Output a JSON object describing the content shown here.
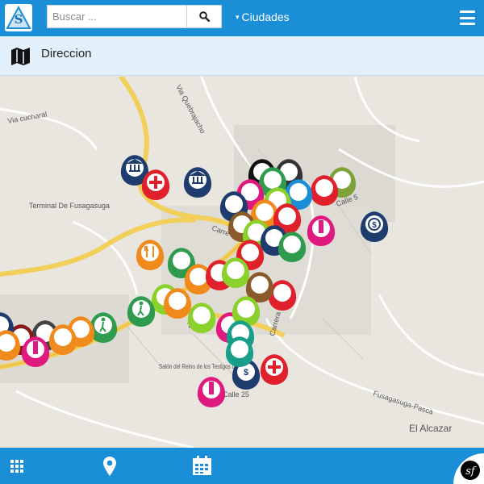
{
  "header": {
    "search_placeholder": "Buscar ...",
    "cities_label": "Ciudades"
  },
  "subbar": {
    "title": "Direccion"
  },
  "map": {
    "streets": [
      "Via cucharal",
      "Via Quebrajacho",
      "Terminal De Fusagasuga",
      "Carre",
      "Carrera 3",
      "Calle 5",
      "Calle 25",
      "Fusagasuga-Pasca",
      "El Alcazar",
      "Salón del Reino de los Testigos de Jehová",
      "Tra",
      "SA"
    ]
  },
  "colors": {
    "primary": "#1a8fd8",
    "subbar": "#e1f0fa",
    "road_yellow": "#f2cf5a",
    "pin_red": "#e0202a",
    "pin_navy": "#1f3c6e",
    "pin_magenta": "#e0197f",
    "pin_orange": "#f18a1c",
    "pin_green": "#2f9b4e",
    "pin_lime": "#8bd12c"
  },
  "icons": [
    "logo",
    "search-icon",
    "chevron-down-icon",
    "hamburger-icon",
    "map-icon",
    "grid-icon",
    "location-pin-icon",
    "calendar-icon",
    "symfony-icon"
  ]
}
